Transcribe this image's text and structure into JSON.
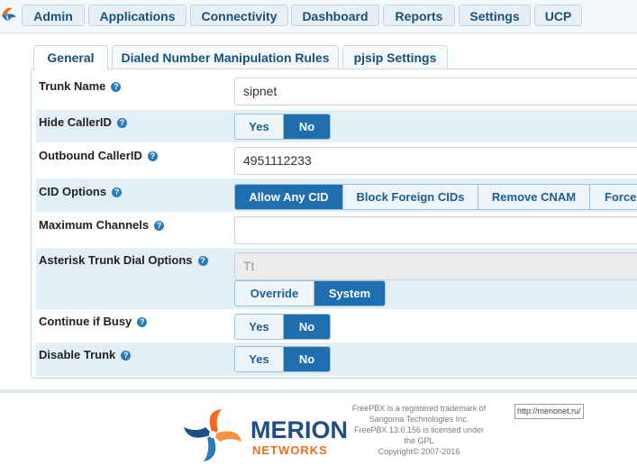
{
  "topnav": {
    "items": [
      {
        "label": "Admin"
      },
      {
        "label": "Applications"
      },
      {
        "label": "Connectivity"
      },
      {
        "label": "Dashboard"
      },
      {
        "label": "Reports"
      },
      {
        "label": "Settings"
      },
      {
        "label": "UCP"
      }
    ]
  },
  "tabs": [
    {
      "label": "General"
    },
    {
      "label": "Dialed Number Manipulation Rules"
    },
    {
      "label": "pjsip Settings"
    }
  ],
  "form": {
    "trunk_name": {
      "label": "Trunk Name",
      "value": "sipnet"
    },
    "hide_callerid": {
      "label": "Hide CallerID",
      "yes": "Yes",
      "no": "No",
      "selected": "No"
    },
    "outbound_callerid": {
      "label": "Outbound CallerID",
      "value": "4951112233"
    },
    "cid_options": {
      "label": "CID Options",
      "options": [
        "Allow Any CID",
        "Block Foreign CIDs",
        "Remove CNAM",
        "Force"
      ],
      "selected": "Allow Any CID"
    },
    "maximum_channels": {
      "label": "Maximum Channels",
      "value": ""
    },
    "dial_options": {
      "label": "Asterisk Trunk Dial Options",
      "value": "Tt",
      "override": "Override",
      "system": "System",
      "selected": "System"
    },
    "continue_if_busy": {
      "label": "Continue if Busy",
      "yes": "Yes",
      "no": "No",
      "selected": "No"
    },
    "disable_trunk": {
      "label": "Disable Trunk",
      "yes": "Yes",
      "no": "No",
      "selected": "No"
    }
  },
  "footer": {
    "line1": "FreePBX is a registered trademark of",
    "line2": "Sangoma Technologies Inc.",
    "line3": "FreePBX 13.0.156 is licensed under",
    "line4": "the GPL",
    "line5": "Copyright© 2007-2016",
    "link": "http://merionet.ru/",
    "brand_name": "MERION",
    "brand_sub": "NETWORKS"
  },
  "colors": {
    "accent": "#1f6eae",
    "nav_text": "#1a4f7a",
    "shaded_row": "#e3eff7",
    "brand_blue": "#1f4e86",
    "brand_orange": "#f26a1f"
  },
  "icons": [
    "freepbx-logo-icon",
    "help-icon",
    "merion-logo-icon"
  ]
}
